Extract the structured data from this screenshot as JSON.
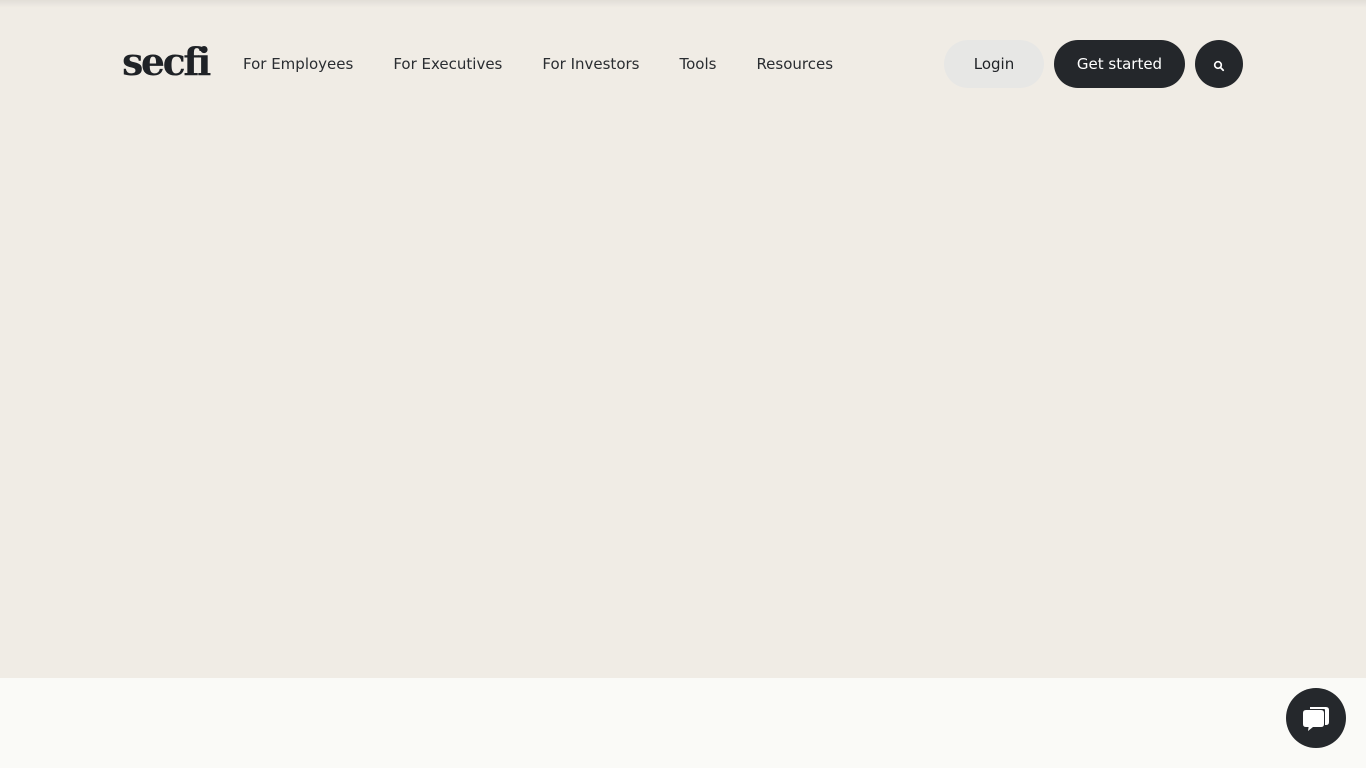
{
  "brand": {
    "logo_text": "secfi"
  },
  "nav": {
    "items": [
      {
        "label": "For Employees"
      },
      {
        "label": "For Executives"
      },
      {
        "label": "For Investors"
      },
      {
        "label": "Tools"
      },
      {
        "label": "Resources"
      }
    ]
  },
  "actions": {
    "login_label": "Login",
    "get_started_label": "Get started",
    "search_icon": "search-icon"
  },
  "chat": {
    "icon": "chat-bubble-icon"
  },
  "colors": {
    "hero_background": "#f0ece5",
    "below_background": "#fafaf7",
    "dark_button": "#24272b",
    "light_button": "#e7e7e5"
  }
}
